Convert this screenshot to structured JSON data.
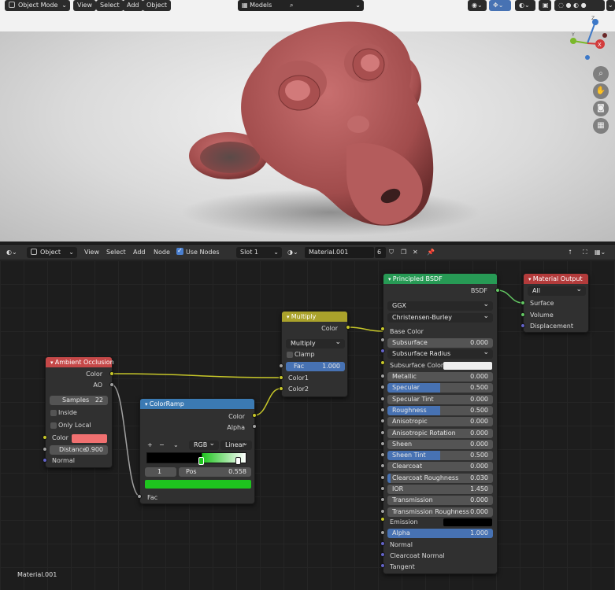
{
  "viewport_header": {
    "mode": "Object Mode",
    "menus": [
      "View",
      "Select",
      "Add",
      "Object"
    ],
    "collection_label": "Models",
    "collection_search": ""
  },
  "viewport_nav": {
    "axes": [
      "Y",
      "X",
      "Z"
    ],
    "tools": [
      "magnify-icon",
      "hand-icon",
      "camera-icon",
      "grid-icon"
    ]
  },
  "node_header": {
    "editor_type": "Object",
    "menus": [
      "View",
      "Select",
      "Add",
      "Node"
    ],
    "use_nodes_label": "Use Nodes",
    "slot": "Slot 1",
    "material_name": "Material.001",
    "users": "6"
  },
  "canvas_footer": "Material.001",
  "nodes": {
    "ambient_occlusion": {
      "title": "Ambient Occlusion",
      "out_color": "Color",
      "out_ao": "AO",
      "samples_label": "Samples",
      "samples_value": "22",
      "inside_label": "Inside",
      "only_local_label": "Only Local",
      "color_label": "Color",
      "color_swatch": "#f07070",
      "distance_label": "Distance",
      "distance_value": "0.900",
      "normal_label": "Normal"
    },
    "color_ramp": {
      "title": "ColorRamp",
      "out_color": "Color",
      "out_alpha": "Alpha",
      "mode": "RGB",
      "interp": "Linear",
      "stop_index": "1",
      "pos_label": "Pos",
      "pos_value": "0.558",
      "stop_color": "#1ec41e",
      "fac_label": "Fac"
    },
    "multiply": {
      "title": "Multiply",
      "out_color": "Color",
      "blend": "Multiply",
      "clamp_label": "Clamp",
      "fac_label": "Fac",
      "fac_value": "1.000",
      "color1": "Color1",
      "color2": "Color2"
    },
    "principled": {
      "title": "Principled BSDF",
      "out_bsdf": "BSDF",
      "distribution": "GGX",
      "subsurface_method": "Christensen-Burley",
      "base_color": "Base Color",
      "subsurface_label": "Subsurface",
      "subsurface_value": "0.000",
      "subsurface_radius": "Subsurface Radius",
      "subsurface_color": "Subsurface Color",
      "params": [
        {
          "label": "Metallic",
          "value": "0.000",
          "fill": 0.0
        },
        {
          "label": "Specular",
          "value": "0.500",
          "fill": 0.5
        },
        {
          "label": "Specular Tint",
          "value": "0.000",
          "fill": 0.0
        },
        {
          "label": "Roughness",
          "value": "0.500",
          "fill": 0.5
        },
        {
          "label": "Anisotropic",
          "value": "0.000",
          "fill": 0.0
        },
        {
          "label": "Anisotropic Rotation",
          "value": "0.000",
          "fill": 0.0
        },
        {
          "label": "Sheen",
          "value": "0.000",
          "fill": 0.0
        },
        {
          "label": "Sheen Tint",
          "value": "0.500",
          "fill": 0.5
        },
        {
          "label": "Clearcoat",
          "value": "0.000",
          "fill": 0.0
        },
        {
          "label": "Clearcoat Roughness",
          "value": "0.030",
          "fill": 0.03
        },
        {
          "label": "IOR",
          "value": "1.450",
          "fill": 0.0
        },
        {
          "label": "Transmission",
          "value": "0.000",
          "fill": 0.0
        },
        {
          "label": "Transmission Roughness",
          "value": "0.000",
          "fill": 0.0
        }
      ],
      "emission_label": "Emission",
      "alpha_label": "Alpha",
      "alpha_value": "1.000",
      "normal_label": "Normal",
      "clearcoat_normal_label": "Clearcoat Normal",
      "tangent_label": "Tangent"
    },
    "material_output": {
      "title": "Material Output",
      "target": "All",
      "surface": "Surface",
      "volume": "Volume",
      "displacement": "Displacement"
    }
  },
  "colors": {
    "header_input": "#c54848",
    "header_converter": "#3b7ab3",
    "header_color": "#aaa22b",
    "header_shader": "#279a55",
    "header_output": "#b33b3b",
    "monkey": "#b55a5a"
  }
}
